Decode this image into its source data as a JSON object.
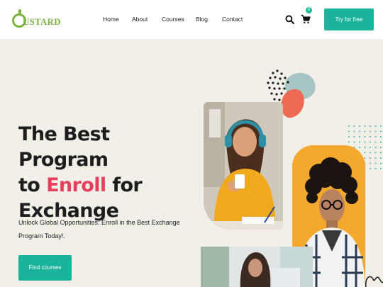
{
  "brand": {
    "logo_text": "USTARD"
  },
  "nav": {
    "home": "Home",
    "about": "About",
    "courses": "Courses",
    "blog": "Blog",
    "contact": "Contact"
  },
  "header": {
    "cart_count": "0",
    "try_label": "Try for free",
    "icons": [
      "search-icon",
      "cart-icon"
    ]
  },
  "hero": {
    "title_line1": "The Best Program",
    "title_to": "to ",
    "title_accent": "Enroll",
    "title_for": " for",
    "title_line3": "Exchange",
    "subtitle_line1": "Unlock Global Opportunities: Enroll in the Best Exchange",
    "subtitle_line2": "Program Today!.",
    "cta_label": "Find courses"
  },
  "colors": {
    "accent": "#1ab39b",
    "highlight": "#e63e5c",
    "logo": "#7cb342",
    "background": "#f2efe9"
  }
}
